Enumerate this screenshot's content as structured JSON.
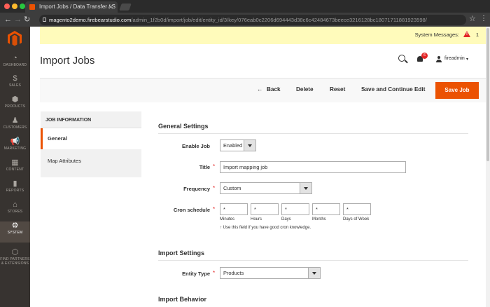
{
  "browser": {
    "tab_title": "Import Jobs / Data Transfer / S",
    "url_prefix": "magento2demo.firebearstudio.com",
    "url_rest": "/admin_1f2b0d/import/job/edit/entity_id/3/key/076eab0c2206d694443d38c6c42484673beece3216128bc18071711881923598/",
    "dot_colors": [
      "#ff5f57",
      "#febc2e",
      "#28c840"
    ]
  },
  "sidebar": {
    "items": [
      {
        "label": "DASHBOARD",
        "icon": "dashboard-icon",
        "glyph": "◔"
      },
      {
        "label": "SALES",
        "icon": "dollar-icon",
        "glyph": "$"
      },
      {
        "label": "PRODUCTS",
        "icon": "box-icon",
        "glyph": "⬢"
      },
      {
        "label": "CUSTOMERS",
        "icon": "person-icon",
        "glyph": "♟"
      },
      {
        "label": "MARKETING",
        "icon": "megaphone-icon",
        "glyph": "📢"
      },
      {
        "label": "CONTENT",
        "icon": "content-icon",
        "glyph": "▦"
      },
      {
        "label": "REPORTS",
        "icon": "bar-chart-icon",
        "glyph": "▮"
      },
      {
        "label": "STORES",
        "icon": "store-icon",
        "glyph": "⌂"
      },
      {
        "label": "SYSTEM",
        "icon": "gear-icon",
        "glyph": "⚙"
      },
      {
        "label": "FIND PARTNERS & EXTENSIONS",
        "icon": "partners-icon",
        "glyph": "⬡"
      }
    ],
    "active": "SYSTEM",
    "brand_color": "#eb5202"
  },
  "system_messages": {
    "label": "System Messages:",
    "count": "1"
  },
  "header": {
    "title": "Import Jobs",
    "notification_count": "6",
    "username": "fireadmin"
  },
  "actions": {
    "back": "Back",
    "delete": "Delete",
    "reset": "Reset",
    "save_continue": "Save and Continue Edit",
    "save": "Save Job"
  },
  "left_panel": {
    "heading": "JOB INFORMATION",
    "items": [
      "General",
      "Map Attributes"
    ]
  },
  "general_settings": {
    "title": "General Settings",
    "enable_job": {
      "label": "Enable Job",
      "value": "Enabled"
    },
    "title_field": {
      "label": "Title",
      "value": "Import mapping job"
    },
    "frequency": {
      "label": "Frequency",
      "value": "Custom"
    },
    "cron": {
      "label": "Cron schedule",
      "fields": [
        {
          "value": "*",
          "caption": "Minutes"
        },
        {
          "value": "*",
          "caption": "Hours"
        },
        {
          "value": "*",
          "caption": "Days"
        },
        {
          "value": "*",
          "caption": "Months"
        },
        {
          "value": "*",
          "caption": "Days of Week"
        }
      ],
      "note": "↑ Use this field if you have good cron knowledge."
    }
  },
  "import_settings": {
    "title": "Import Settings",
    "entity_type": {
      "label": "Entity Type",
      "value": "Products"
    }
  },
  "import_behavior": {
    "title": "Import Behavior"
  }
}
